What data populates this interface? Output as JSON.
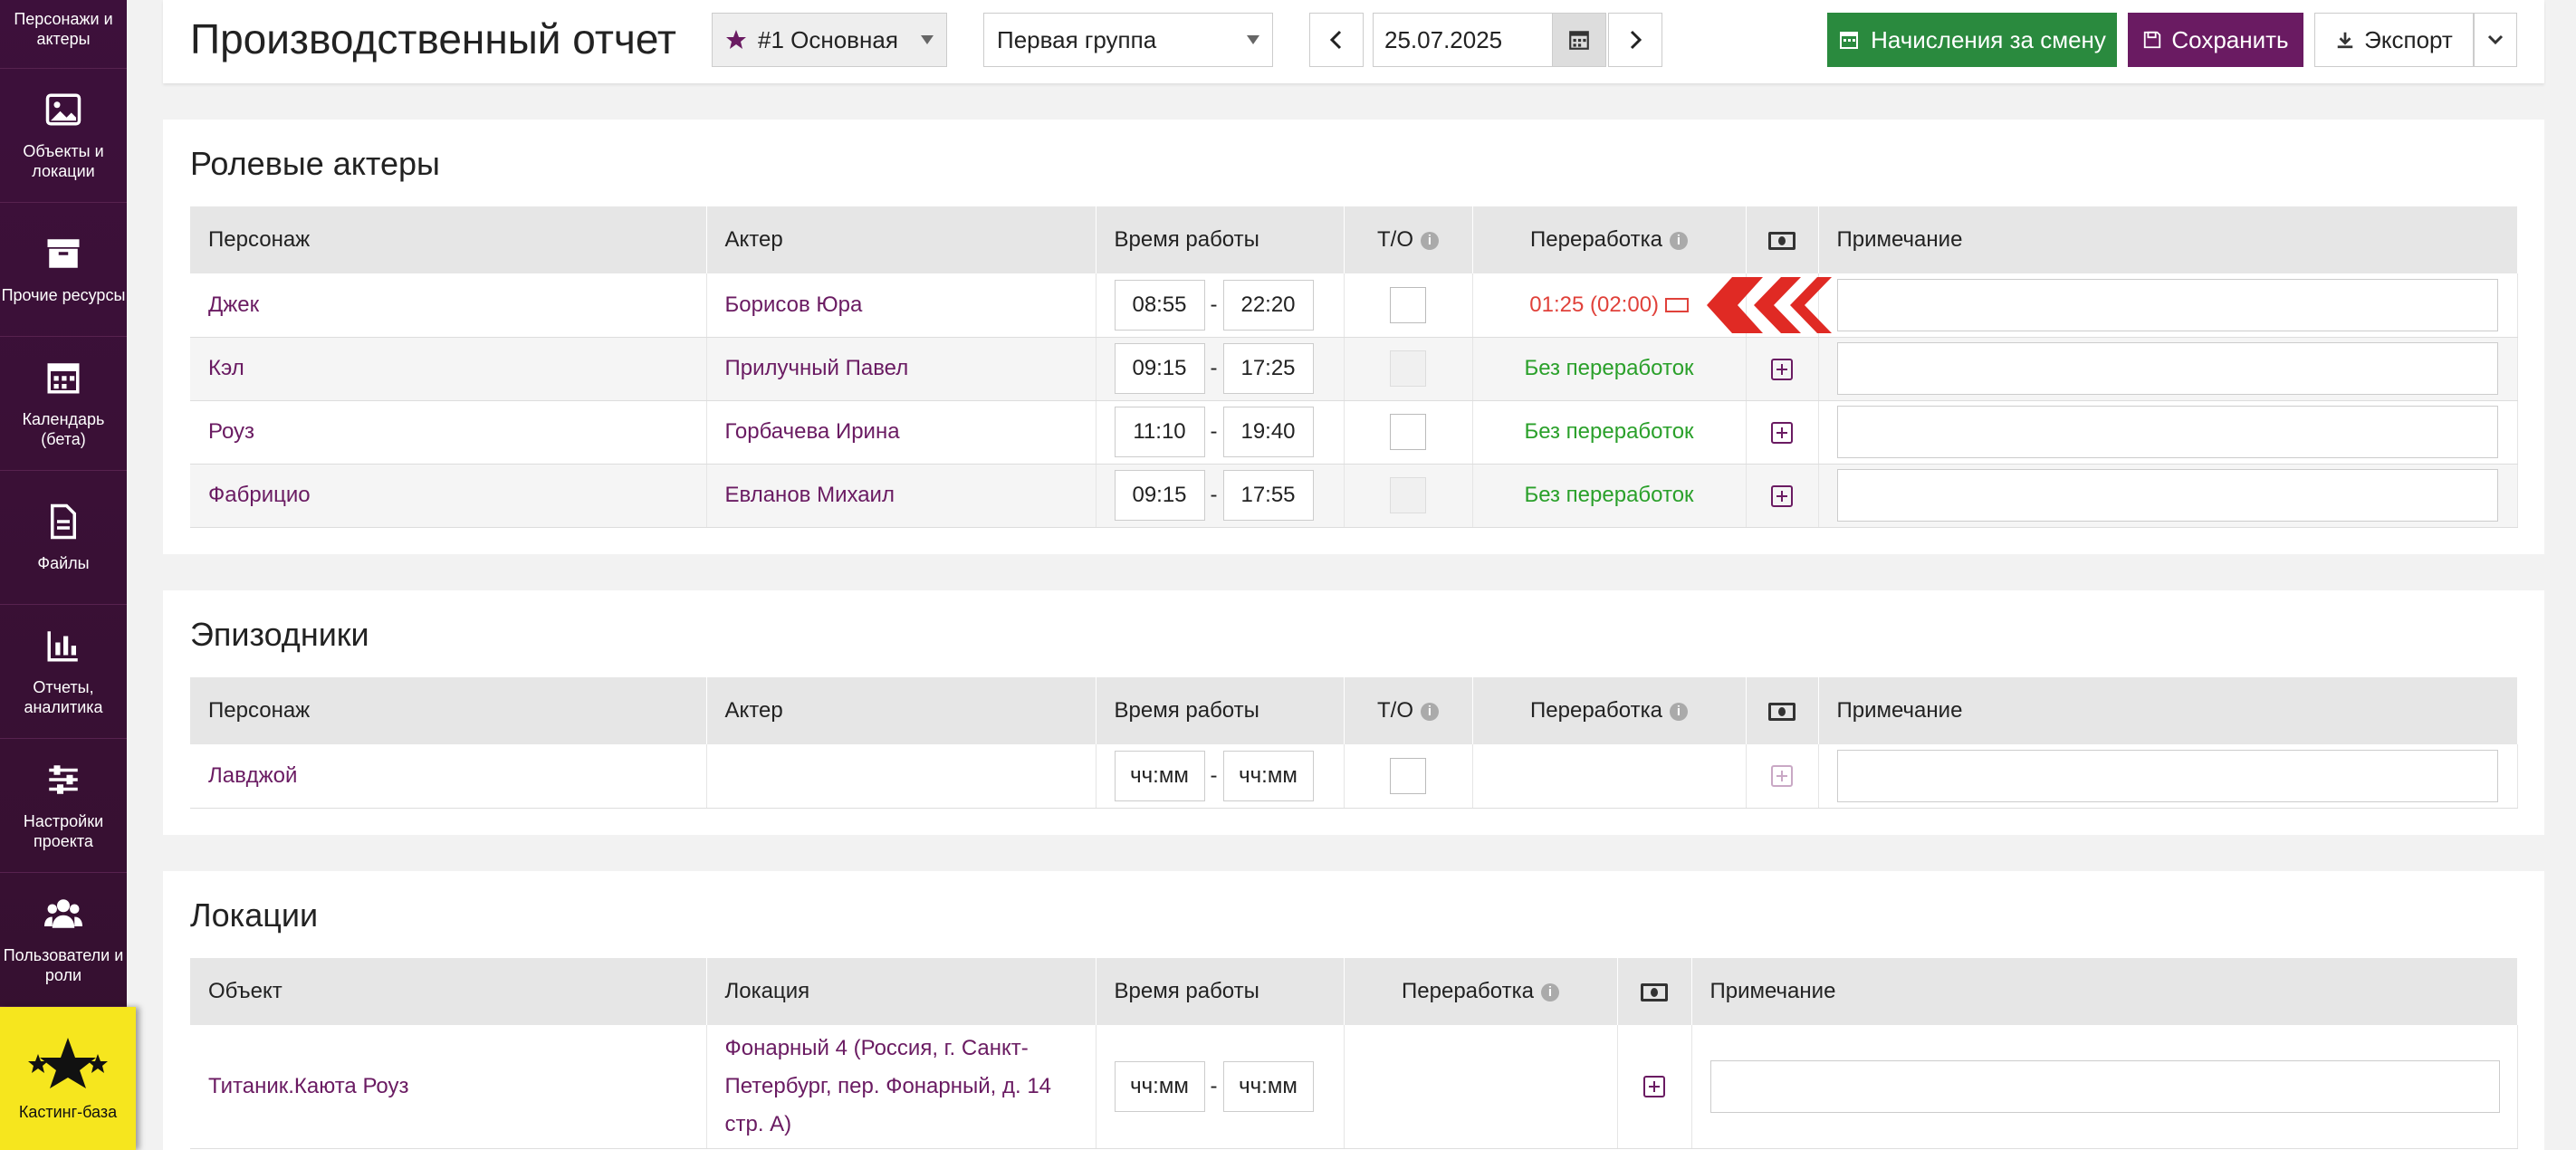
{
  "sidebar": {
    "items": [
      {
        "label": "Персонажи и актеры",
        "icon": "user-icon"
      },
      {
        "label": "Объекты и локации",
        "icon": "image-icon"
      },
      {
        "label": "Прочие ресурсы",
        "icon": "archive-icon"
      },
      {
        "label": "Календарь (бета)",
        "icon": "calendar-icon"
      },
      {
        "label": "Файлы",
        "icon": "file-icon"
      },
      {
        "label": "Отчеты, аналитика",
        "icon": "bar-chart-icon"
      },
      {
        "label": "Настройки проекта",
        "icon": "sliders-icon"
      },
      {
        "label": "Пользователи и роли",
        "icon": "users-icon"
      }
    ],
    "casting": {
      "label": "Кастинг-база",
      "icon": "stars-icon"
    }
  },
  "header": {
    "title": "Производственный отчет",
    "shooting_day": "#1 Основная",
    "group": "Первая группа",
    "date": "25.07.2025",
    "accruals_label": "Начисления за смену",
    "save_label": "Сохранить",
    "export_label": "Экспорт"
  },
  "colors": {
    "accent": "#6a1b62",
    "green_button": "#2a8a3e",
    "save_button": "#6a1b62",
    "overtime_red": "#e0413a",
    "ok_green": "#2aa02a"
  },
  "roles": {
    "title": "Ролевые актеры",
    "headers": {
      "character": "Персонаж",
      "actor": "Актер",
      "work_time": "Время работы",
      "to": "Т/О",
      "overtime": "Переработка",
      "note": "Примечание"
    },
    "rows": [
      {
        "character": "Джек",
        "actor": "Борисов Юра",
        "start": "08:55",
        "end": "22:20",
        "overtime": "01:25 (02:00)"
      },
      {
        "character": "Кэл",
        "actor": "Прилучный Павел",
        "start": "09:15",
        "end": "17:25",
        "overtime": "Без переработок"
      },
      {
        "character": "Роуз",
        "actor": "Горбачева Ирина",
        "start": "11:10",
        "end": "19:40",
        "overtime": "Без переработок"
      },
      {
        "character": "Фабрицио",
        "actor": "Евланов Михаил",
        "start": "09:15",
        "end": "17:55",
        "overtime": "Без переработок"
      }
    ]
  },
  "extras": {
    "title": "Эпизодники",
    "headers": {
      "character": "Персонаж",
      "actor": "Актер",
      "work_time": "Время работы",
      "to": "Т/О",
      "overtime": "Переработка",
      "note": "Примечание"
    },
    "rows": [
      {
        "character": "Лавджой",
        "actor": "",
        "start_placeholder": "чч:мм",
        "end_placeholder": "чч:мм"
      }
    ]
  },
  "locations": {
    "title": "Локации",
    "headers": {
      "object": "Объект",
      "location": "Локация",
      "work_time": "Время работы",
      "overtime": "Переработка",
      "note": "Примечание"
    },
    "rows": [
      {
        "object": "Титаник.Каюта Роуз",
        "location": "Фонарный 4 (Россия, г. Санкт-Петербург, пер. Фонарный, д. 14 стр. А)",
        "start_placeholder": "чч:мм",
        "end_placeholder": "чч:мм"
      }
    ]
  }
}
